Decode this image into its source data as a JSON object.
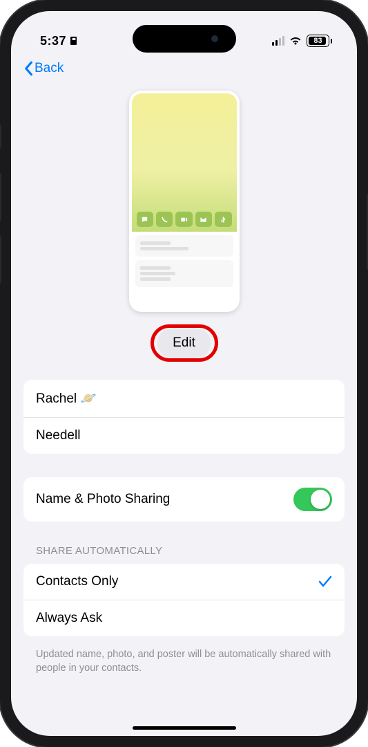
{
  "status": {
    "time": "5:37",
    "battery": "83"
  },
  "nav": {
    "back": "Back"
  },
  "edit": {
    "label": "Edit"
  },
  "name": {
    "first": "Rachel 🪐",
    "last": "Needell"
  },
  "sharing": {
    "label": "Name & Photo Sharing"
  },
  "shareAuto": {
    "header": "SHARE AUTOMATICALLY",
    "options": [
      "Contacts Only",
      "Always Ask"
    ],
    "footer": "Updated name, photo, and poster will be automatically shared with people in your contacts."
  }
}
